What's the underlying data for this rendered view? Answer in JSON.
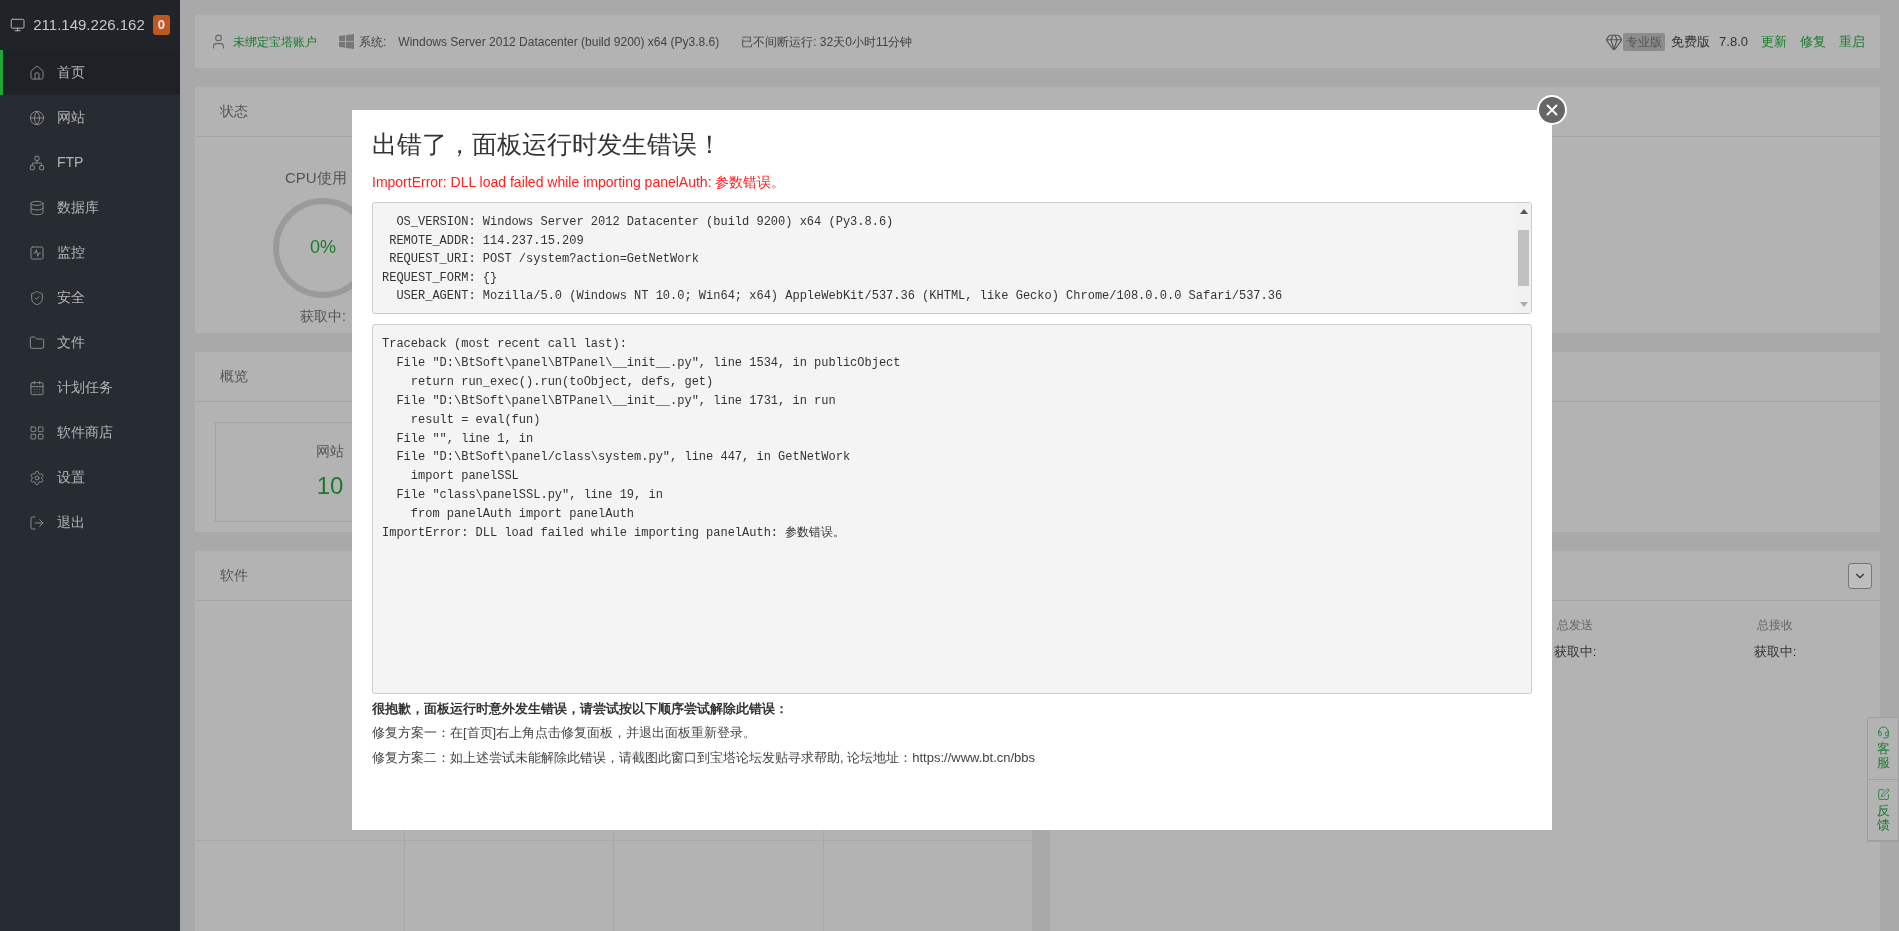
{
  "sidebar": {
    "host": "211.149.226.162",
    "badge": "0",
    "items": [
      {
        "label": "首页",
        "kind": "home",
        "selected": true
      },
      {
        "label": "网站",
        "kind": "globe",
        "selected": false
      },
      {
        "label": "FTP",
        "kind": "ftp",
        "selected": false
      },
      {
        "label": "数据库",
        "kind": "database",
        "selected": false
      },
      {
        "label": "监控",
        "kind": "monitor",
        "selected": false
      },
      {
        "label": "安全",
        "kind": "shield",
        "selected": false
      },
      {
        "label": "文件",
        "kind": "folder",
        "selected": false
      },
      {
        "label": "计划任务",
        "kind": "calendar",
        "selected": false
      },
      {
        "label": "软件商店",
        "kind": "grid",
        "selected": false
      },
      {
        "label": "设置",
        "kind": "settings",
        "selected": false
      },
      {
        "label": "退出",
        "kind": "logout",
        "selected": false
      }
    ]
  },
  "topbar": {
    "account": "未绑定宝塔账户",
    "system_label": "系统:",
    "system": "Windows Server 2012 Datacenter (build 9200) x64 (Py3.8.6)",
    "uptime": "已不间断运行: 32天0小时11分钟",
    "pro_badge": "专业版",
    "edition": "免费版",
    "version": "7.8.0",
    "actions": [
      "更新",
      "修复",
      "重启"
    ]
  },
  "status_card": {
    "title": "状态",
    "gauge_label": "CPU使用",
    "gauge_value": "0%",
    "gauge_status": "获取中:"
  },
  "overview_card": {
    "title": "概览",
    "stat_label": "网站",
    "stat_value": "10"
  },
  "software_card": {
    "title": "软件"
  },
  "network_card": {
    "columns": [
      {
        "label": "总发送",
        "value": "获取中:"
      },
      {
        "label": "总接收",
        "value": "获取中:"
      }
    ]
  },
  "float_buttons": [
    {
      "label": "客服",
      "kind": "headset"
    },
    {
      "label": "反馈",
      "kind": "edit"
    }
  ],
  "modal": {
    "title": "出错了，面板运行时发生错误！",
    "error": "ImportError: DLL load failed while importing panelAuth: 参数错误。",
    "env_lines": [
      "  OS_VERSION: Windows Server 2012 Datacenter (build 9200) x64 (Py3.8.6)",
      " REMOTE_ADDR: 114.237.15.209",
      " REQUEST_URI: POST /system?action=GetNetWork",
      "REQUEST_FORM: {}",
      "  USER_AGENT: Mozilla/5.0 (Windows NT 10.0; Win64; x64) AppleWebKit/537.36 (KHTML, like Gecko) Chrome/108.0.0.0 Safari/537.36"
    ],
    "traceback": [
      "Traceback (most recent call last):",
      "  File \"D:\\BtSoft\\panel\\BTPanel\\__init__.py\", line 1534, in publicObject",
      "    return run_exec().run(toObject, defs, get)",
      "  File \"D:\\BtSoft\\panel\\BTPanel\\__init__.py\", line 1731, in run",
      "    result = eval(fun)",
      "  File \"\", line 1, in",
      "  File \"D:\\BtSoft\\panel/class\\system.py\", line 447, in GetNetWork",
      "    import panelSSL",
      "  File \"class\\panelSSL.py\", line 19, in",
      "    from panelAuth import panelAuth",
      "ImportError: DLL load failed while importing panelAuth: 参数错误。"
    ],
    "help_title": "很抱歉，面板运行时意外发生错误，请尝试按以下顺序尝试解除此错误：",
    "help_lines": [
      "修复方案一：在[首页]右上角点击修复面板，并退出面板重新登录。",
      "修复方案二：如上述尝试未能解除此错误，请截图此窗口到宝塔论坛发贴寻求帮助, 论坛地址：https://www.bt.cn/bbs"
    ]
  }
}
